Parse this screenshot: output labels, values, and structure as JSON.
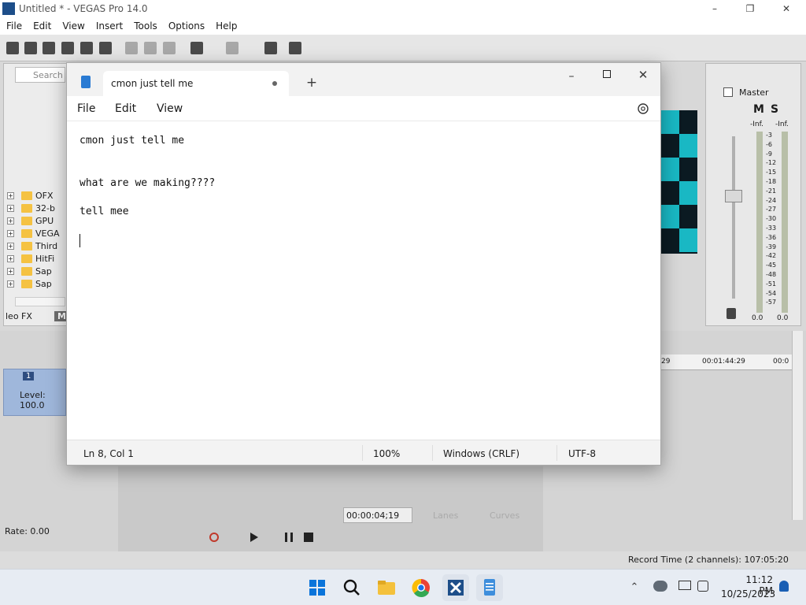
{
  "vegas": {
    "title": "Untitled * - VEGAS Pro 14.0",
    "menu": [
      "File",
      "Edit",
      "View",
      "Insert",
      "Tools",
      "Options",
      "Help"
    ],
    "explorer": {
      "search_placeholder": "Search",
      "folders": [
        "OFX",
        "32-b",
        "GPU",
        "VEGA",
        "Third",
        "HitFi",
        "Sap",
        "Sap"
      ],
      "tabs": [
        "leo FX",
        "Me"
      ]
    },
    "mixer": {
      "master_label": "Master",
      "m_label": "M",
      "s_label": "S",
      "peak_left": "-Inf.",
      "peak_right": "-Inf.",
      "scale": [
        "3",
        "6",
        "9",
        "12",
        "15",
        "18",
        "21",
        "24",
        "27",
        "30",
        "33",
        "36",
        "39",
        "42",
        "45",
        "48",
        "51",
        "54",
        "57"
      ],
      "level_left": "0.0",
      "level_right": "0.0"
    },
    "timeline": {
      "ruler_left": "29",
      "ruler_mid": "00:01:44:29",
      "ruler_right": "00:0",
      "track_number": "1",
      "track_level": "Level: 100.0",
      "timecode": "00:00:04;19",
      "lanes_label": "Lanes",
      "curves_label": "Curves",
      "rate": "Rate: 0.00",
      "record_time": "Record Time (2 channels): 107:05:20"
    }
  },
  "notepad": {
    "tab_title": "cmon just tell me",
    "new_tab_glyph": "+",
    "menu": [
      "File",
      "Edit",
      "View"
    ],
    "lines": [
      "cmon just tell me",
      "",
      "what are we making????",
      "",
      "tell mee",
      ""
    ],
    "status": {
      "position": "Ln 8, Col 1",
      "zoom": "100%",
      "line_ending": "Windows (CRLF)",
      "encoding": "UTF-8"
    }
  },
  "taskbar": {
    "time": "11:12 PM",
    "date": "10/25/2023"
  },
  "colors": {
    "accent_blue": "#1a73e8",
    "preview_cyan": "#19b8c4",
    "track_header": "#9fb7db"
  }
}
